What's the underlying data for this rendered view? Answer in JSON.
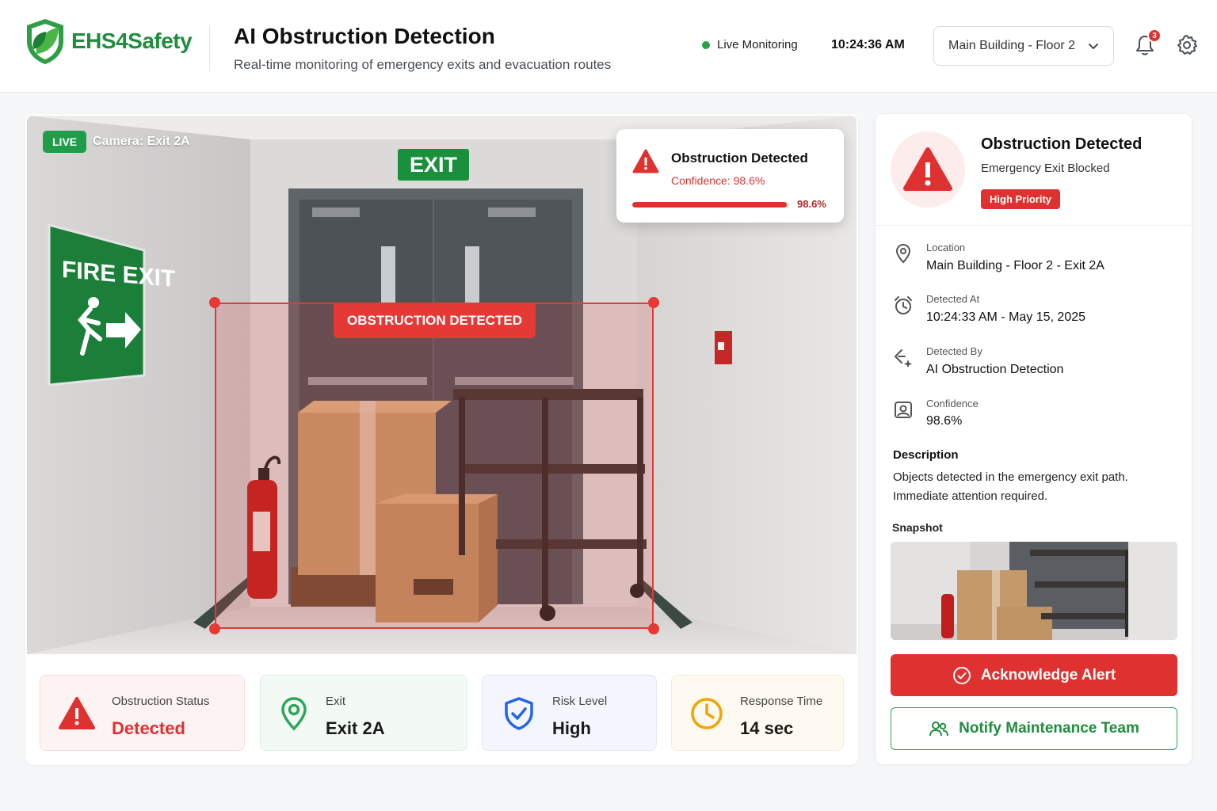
{
  "brand": {
    "name": "EHS4Safety"
  },
  "header": {
    "title": "AI Obstruction Detection",
    "subtitle": "Real-time monitoring of emergency exits and evacuation routes",
    "live_status": "Live Monitoring",
    "time": "10:24:36 AM",
    "location_select": "Main Building - Floor 2",
    "notification_count": "3"
  },
  "camera": {
    "live_chip": "LIVE",
    "label": "Camera: Exit 2A",
    "exit_sign": "EXIT",
    "fire_exit_sign": "FIRE EXIT",
    "detection_tag": "OBSTRUCTION DETECTED",
    "popup": {
      "title": "Obstruction Detected",
      "confidence_text": "Confidence: 98.6%",
      "confidence_value": 0.986,
      "confidence_pct": "98.6%"
    }
  },
  "stats": [
    {
      "label": "Obstruction Status",
      "value": "Detected",
      "icon": "warning-icon",
      "color": "#e03131"
    },
    {
      "label": "Exit",
      "value": "Exit 2A",
      "icon": "location-pin-icon",
      "color": "#2da659"
    },
    {
      "label": "Risk Level",
      "value": "High",
      "icon": "shield-check-icon",
      "color": "#2563eb"
    },
    {
      "label": "Response Time",
      "value": "14 sec",
      "icon": "clock-icon",
      "color": "#f0a500"
    }
  ],
  "alert": {
    "title": "Obstruction Detected",
    "subtitle": "Emergency Exit Blocked",
    "priority": "High Priority",
    "details": [
      {
        "label": "Location",
        "value": "Main Building - Floor 2 - Exit 2A",
        "icon": "location-pin-icon"
      },
      {
        "label": "Detected At",
        "value": "10:24:33 AM - May 15, 2025",
        "icon": "alarm-clock-icon"
      },
      {
        "label": "Detected By",
        "value": "AI Obstruction Detection",
        "icon": "ai-sparkle-icon"
      },
      {
        "label": "Confidence",
        "value": "98.6%",
        "icon": "confidence-image-icon"
      }
    ],
    "description_heading": "Description",
    "description": "Objects detected in the emergency exit path. Immediate attention required.",
    "snapshot_heading": "Snapshot",
    "acknowledge_label": "Acknowledge Alert",
    "notify_label": "Notify Maintenance Team"
  },
  "colors": {
    "brand_green": "#1e8e3e",
    "alert_red": "#e03131",
    "live_green": "#22a447"
  }
}
